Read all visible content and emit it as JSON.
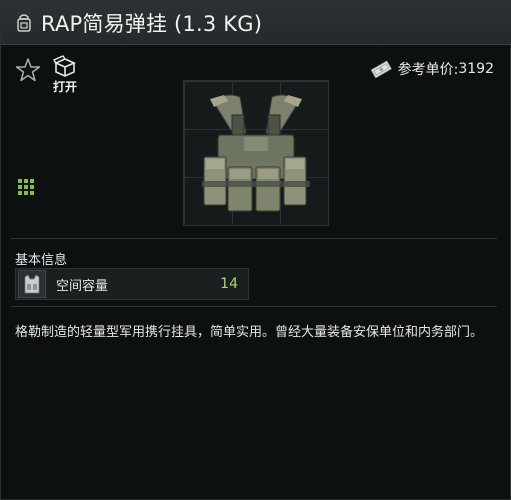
{
  "header": {
    "title": "RAP简易弹挂 (1.3 KG)"
  },
  "actions": {
    "open_label": "打开"
  },
  "price": {
    "label": "参考单价:",
    "value": "3192"
  },
  "basic_info": {
    "section_label": "基本信息",
    "stats": [
      {
        "label": "空间容量",
        "value": "14"
      }
    ]
  },
  "description": "格勒制造的轻量型军用携行挂具，简单实用。曾经大量装备安保单位和内务部门。",
  "colors": {
    "accent_green": "#b5d46a",
    "size_icon_green": "#7fc23a"
  },
  "icons": [
    "backpack-icon",
    "star-icon",
    "box-open-icon",
    "money-icon",
    "item-size-icon",
    "vest-icon"
  ]
}
